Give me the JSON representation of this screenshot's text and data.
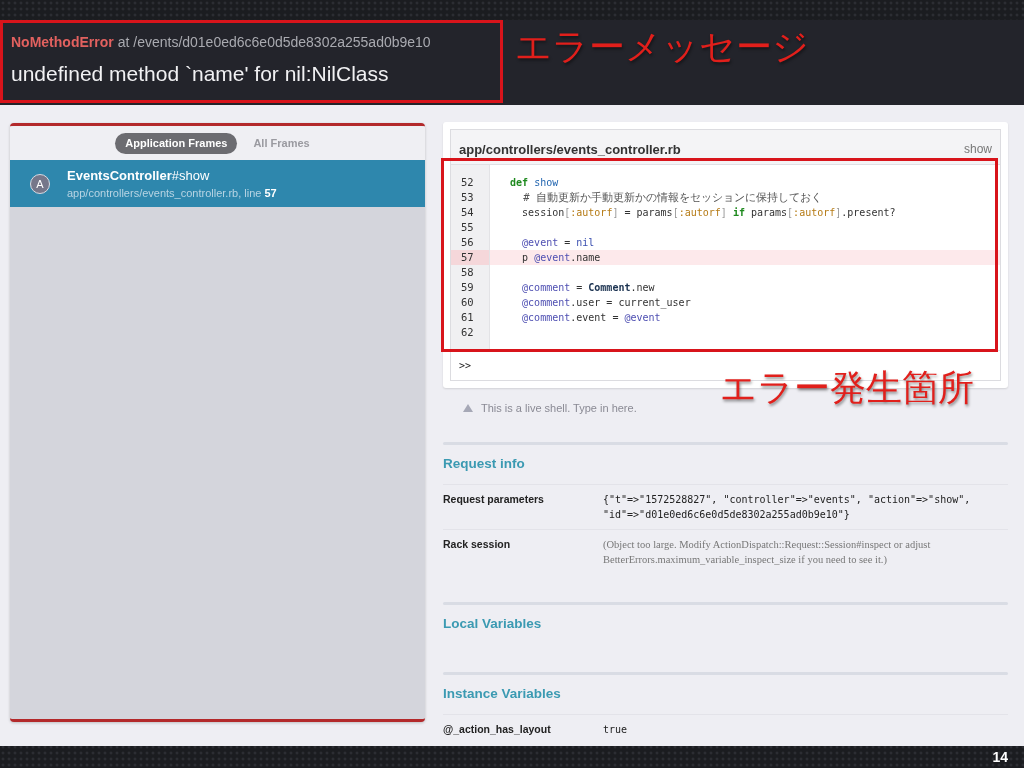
{
  "error_header": {
    "exception": "NoMethodError",
    "location": "at /events/d01e0ed6c6e0d5de8302a255ad0b9e10",
    "message": "undefined method `name' for nil:NilClass",
    "annotation": "エラーメッセージ"
  },
  "frames_panel": {
    "tabs": [
      {
        "label": "Application Frames",
        "selected": true
      },
      {
        "label": "All Frames",
        "selected": false
      }
    ],
    "frames": [
      {
        "badge": "A",
        "title": "**EventsController**#show",
        "location": "app/controllers/events_controller.rb, line **57**",
        "selected": true
      }
    ]
  },
  "code_view": {
    "file": "app/controllers/events_controller.rb",
    "method": "show",
    "lines": [
      {
        "number": "52",
        "highlighted": false,
        "tokens": [
          {
            "text": "  def",
            "kind": "keyword"
          },
          {
            "text": " show",
            "kind": "function"
          }
        ]
      },
      {
        "number": "53",
        "highlighted": false,
        "tokens": [
          {
            "text": "    # 自動更新か手動更新かの情報をセッションに保持しておく",
            "kind": "comment"
          }
        ]
      },
      {
        "number": "54",
        "highlighted": false,
        "tokens": [
          {
            "text": "    session",
            "kind": "plain"
          },
          {
            "text": "[",
            "kind": "bracket"
          },
          {
            "text": ":autorf",
            "kind": "symbol"
          },
          {
            "text": "]",
            "kind": "bracket"
          },
          {
            "text": " = params",
            "kind": "plain"
          },
          {
            "text": "[",
            "kind": "bracket"
          },
          {
            "text": ":autorf",
            "kind": "symbol"
          },
          {
            "text": "]",
            "kind": "bracket"
          },
          {
            "text": " if",
            "kind": "keyword"
          },
          {
            "text": " params",
            "kind": "plain"
          },
          {
            "text": "[",
            "kind": "bracket"
          },
          {
            "text": ":autorf",
            "kind": "symbol"
          },
          {
            "text": "]",
            "kind": "bracket"
          },
          {
            "text": ".present?",
            "kind": "plain"
          }
        ]
      },
      {
        "number": "55",
        "highlighted": false
      },
      {
        "number": "56",
        "highlighted": false,
        "tokens": [
          {
            "text": "    @event",
            "kind": "ivar"
          },
          {
            "text": " = ",
            "kind": "plain"
          },
          {
            "text": "nil",
            "kind": "literal"
          }
        ]
      },
      {
        "number": "57",
        "highlighted": true,
        "tokens": [
          {
            "text": "    p ",
            "kind": "plain"
          },
          {
            "text": "@event",
            "kind": "ivar"
          },
          {
            "text": ".name",
            "kind": "plain"
          }
        ]
      },
      {
        "number": "58",
        "highlighted": false
      },
      {
        "number": "59",
        "highlighted": false,
        "tokens": [
          {
            "text": "    @comment",
            "kind": "ivar"
          },
          {
            "text": " = ",
            "kind": "plain"
          },
          {
            "text": "Comment",
            "kind": "constant"
          },
          {
            "text": ".new",
            "kind": "plain"
          }
        ]
      },
      {
        "number": "60",
        "highlighted": false,
        "tokens": [
          {
            "text": "    @comment",
            "kind": "ivar"
          },
          {
            "text": ".user = current_user",
            "kind": "plain"
          }
        ]
      },
      {
        "number": "61",
        "highlighted": false,
        "tokens": [
          {
            "text": "    @comment",
            "kind": "ivar"
          },
          {
            "text": ".event = ",
            "kind": "plain"
          },
          {
            "text": "@event",
            "kind": "ivar"
          }
        ]
      },
      {
        "number": "62",
        "highlighted": false
      }
    ],
    "prompt": ">>",
    "annotation": "エラー発生箇所"
  },
  "shell_hint": "This is a live shell. Type in here.",
  "sections": [
    {
      "title": "Request info",
      "rows": [
        {
          "label": "Request parameters",
          "value": "{\"t\"=>\"1572528827\", \"controller\"=>\"events\", \"action\"=>\"show\", \"id\"=>\"d01e0ed6c6e0d5de8302a255ad0b9e10\"}",
          "kind": "code"
        },
        {
          "label": "Rack session",
          "value": "(Object too large. Modify ActionDispatch::Request::Session#inspect or adjust BetterErrors.maximum_variable_inspect_size if you need to see it.)",
          "kind": "note"
        }
      ]
    },
    {
      "title": "Local Variables"
    },
    {
      "title": "Instance Variables",
      "rows": [
        {
          "label": "@_action_has_layout",
          "value": "true",
          "kind": "code"
        }
      ]
    }
  ],
  "slide_number": "14"
}
